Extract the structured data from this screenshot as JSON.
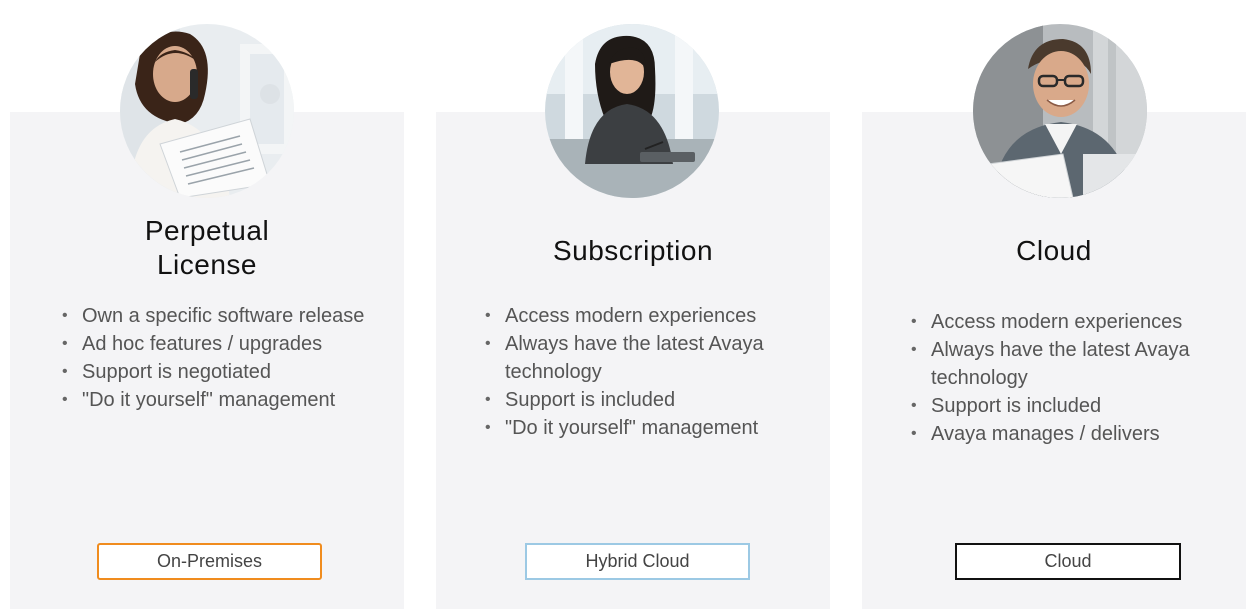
{
  "options": [
    {
      "title_lines": [
        "Perpetual",
        "License"
      ],
      "bullets": [
        "Own a specific software release",
        "Ad hoc features / upgrades",
        "Support is negotiated",
        "\"Do it yourself\" management"
      ],
      "deployment": "On-Premises",
      "deployment_color": "#f08c1e",
      "photo": "woman-on-phone-photo"
    },
    {
      "title_lines": [
        "Subscription"
      ],
      "bullets": [
        "Access modern experiences",
        "Always have the latest Avaya technology",
        "Support is included",
        "\"Do it yourself\" management"
      ],
      "deployment": "Hybrid Cloud",
      "deployment_color": "#9cc9e4",
      "photo": "woman-writing-photo"
    },
    {
      "title_lines": [
        "Cloud"
      ],
      "bullets": [
        "Access modern experiences",
        "Always have the latest Avaya technology",
        "Support is included",
        "Avaya manages / delivers"
      ],
      "deployment": "Cloud",
      "deployment_color": "#111111",
      "photo": "smiling-man-photo"
    }
  ]
}
